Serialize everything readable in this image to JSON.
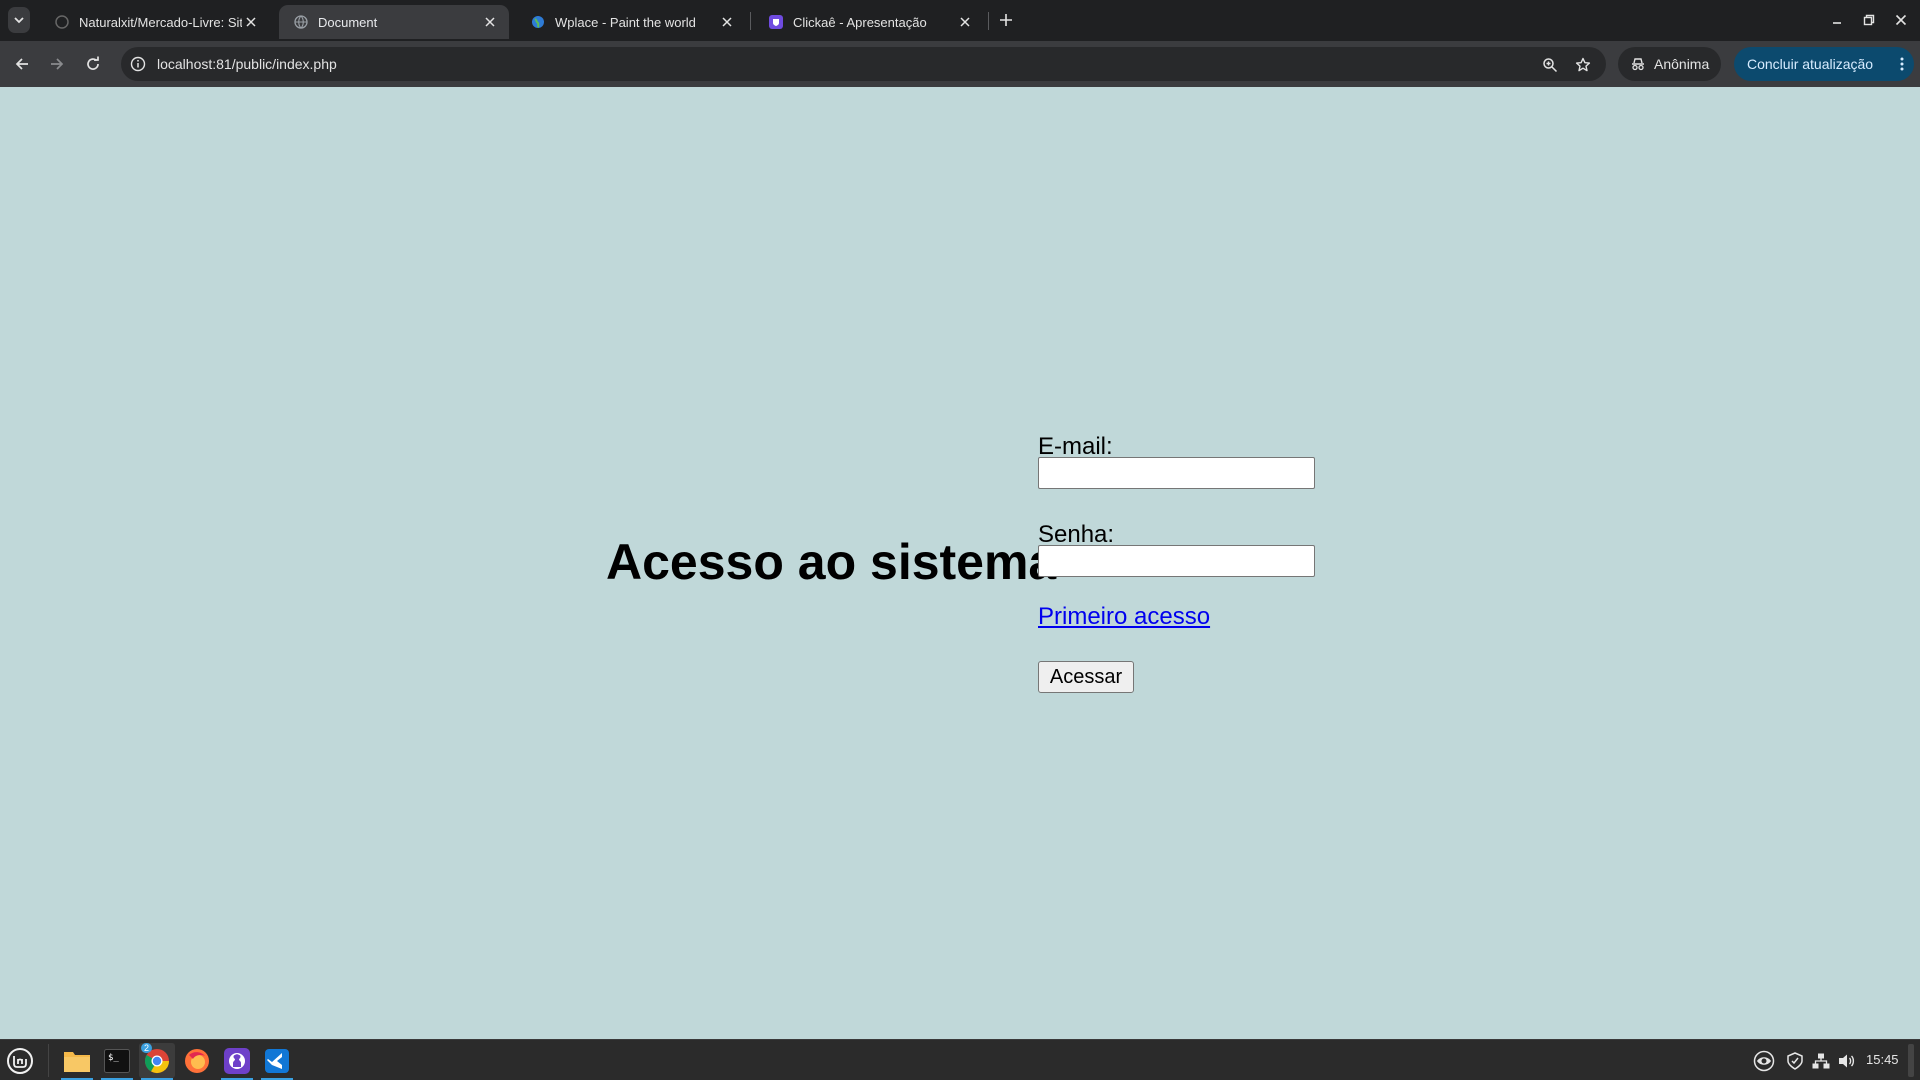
{
  "browser": {
    "tabs": [
      {
        "title": "Naturalxit/Mercado-Livre: Sit",
        "active": false
      },
      {
        "title": "Document",
        "active": true
      },
      {
        "title": "Wplace - Paint the world",
        "active": false
      },
      {
        "title": "Clickaê - Apresentação",
        "active": false
      }
    ],
    "url": "localhost:81/public/index.php",
    "incognito_label": "Anônima",
    "update_label": "Concluir atualização"
  },
  "page": {
    "heading": "Acesso ao sistema",
    "email_label": "E-mail:",
    "email_value": "",
    "password_label": "Senha:",
    "password_value": "",
    "first_access_link": "Primeiro acesso",
    "submit_label": "Acessar",
    "background_color": "#c0d8d9",
    "link_color": "#0000ee"
  },
  "taskbar": {
    "apps": [
      "file-manager-icon",
      "terminal-icon",
      "chrome-icon",
      "firefox-icon",
      "github-desktop-icon",
      "vscode-icon"
    ],
    "chrome_badge": "2",
    "clock": "15:45"
  }
}
